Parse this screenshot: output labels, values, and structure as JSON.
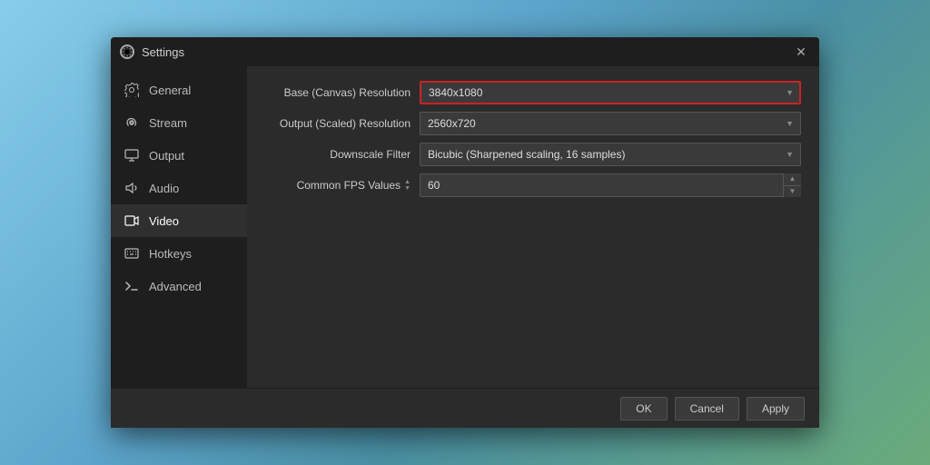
{
  "dialog": {
    "title": "Settings",
    "close_label": "✕"
  },
  "sidebar": {
    "items": [
      {
        "id": "general",
        "label": "General",
        "icon": "gear"
      },
      {
        "id": "stream",
        "label": "Stream",
        "icon": "stream"
      },
      {
        "id": "output",
        "label": "Output",
        "icon": "output"
      },
      {
        "id": "audio",
        "label": "Audio",
        "icon": "audio"
      },
      {
        "id": "video",
        "label": "Video",
        "icon": "video",
        "active": true
      },
      {
        "id": "hotkeys",
        "label": "Hotkeys",
        "icon": "hotkeys"
      },
      {
        "id": "advanced",
        "label": "Advanced",
        "icon": "advanced"
      }
    ]
  },
  "content": {
    "rows": [
      {
        "id": "base-resolution",
        "label": "Base (Canvas) Resolution",
        "type": "select",
        "value": "3840x1080",
        "highlighted": true
      },
      {
        "id": "output-resolution",
        "label": "Output (Scaled) Resolution",
        "type": "select",
        "value": "2560x720",
        "highlighted": false
      },
      {
        "id": "downscale-filter",
        "label": "Downscale Filter",
        "type": "select",
        "value": "Bicubic (Sharpened scaling, 16 samples)",
        "highlighted": false
      },
      {
        "id": "common-fps",
        "label": "Common FPS Values",
        "type": "spinner",
        "value": "60",
        "highlighted": false
      }
    ]
  },
  "footer": {
    "ok_label": "OK",
    "cancel_label": "Cancel",
    "apply_label": "Apply"
  }
}
